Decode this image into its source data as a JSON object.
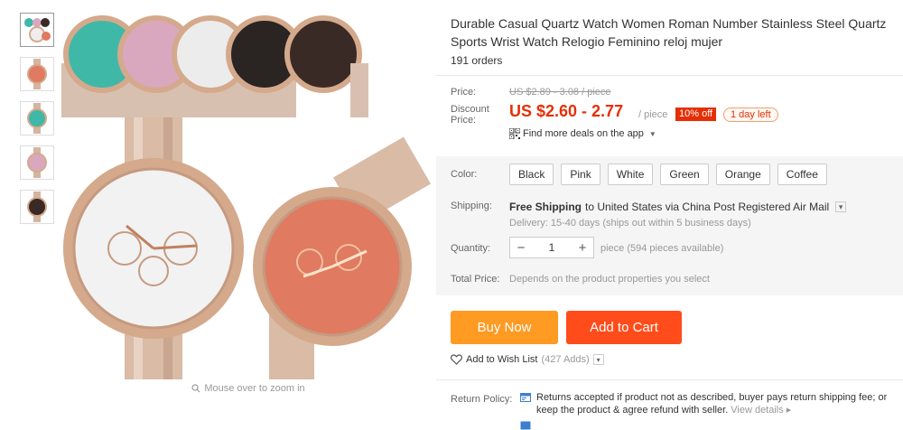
{
  "product": {
    "title": "Durable Casual Quartz Watch Women Roman Number Stainless Steel Quartz Sports Wrist Watch Relogio Feminino reloj mujer",
    "orders": "191 orders"
  },
  "price": {
    "label": "Price:",
    "original": "US $2.89 - 3.08 / piece",
    "discount_label": "Discount Price:",
    "discount": "US $2.60 - 2.77",
    "unit": "/ piece",
    "off_badge": "10% off",
    "days_left": "1 day left",
    "deals_link": "Find more deals on the app"
  },
  "colors": {
    "label": "Color:",
    "options": [
      "Black",
      "Pink",
      "White",
      "Green",
      "Orange",
      "Coffee"
    ]
  },
  "shipping": {
    "label": "Shipping:",
    "free": "Free Shipping",
    "to_text": "to United States via China Post Registered Air Mail",
    "delivery": "Delivery: 15-40 days (ships out within 5 business days)"
  },
  "quantity": {
    "label": "Quantity:",
    "minus": "−",
    "value": "1",
    "plus": "+",
    "available": "piece (594 pieces available)"
  },
  "total": {
    "label": "Total Price:",
    "value": "Depends on the product properties you select"
  },
  "actions": {
    "buy_now": "Buy Now",
    "add_to_cart": "Add to Cart",
    "wish": "Add to Wish List",
    "wish_count": "(427 Adds)"
  },
  "returns": {
    "label": "Return Policy:",
    "text": "Returns accepted if product not as described, buyer pays return shipping fee; or keep the product & agree refund with seller.",
    "link": "View details"
  },
  "gallery": {
    "zoom_hint": "Mouse over to zoom in",
    "thumb_colors": [
      "#c9b0a6",
      "#e07a60",
      "#3fb8a8",
      "#d9a8bf",
      "#3a2a25"
    ]
  },
  "theme": {
    "accent": "#e62e04",
    "buy_color": "#ff9a22",
    "cart_color": "#ff4c1a"
  }
}
